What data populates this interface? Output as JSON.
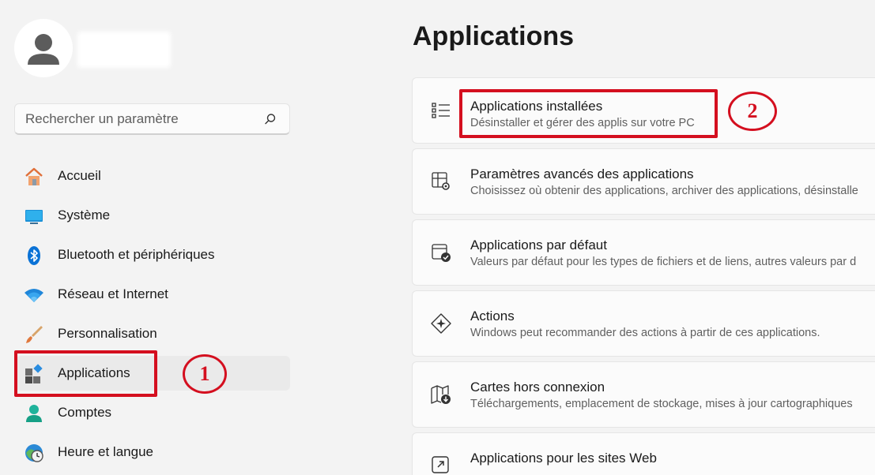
{
  "sidebar": {
    "search_placeholder": "Rechercher un paramètre",
    "items": [
      {
        "label": "Accueil",
        "icon": "home-icon"
      },
      {
        "label": "Système",
        "icon": "monitor-icon"
      },
      {
        "label": "Bluetooth et périphériques",
        "icon": "bluetooth-icon"
      },
      {
        "label": "Réseau et Internet",
        "icon": "wifi-icon"
      },
      {
        "label": "Personnalisation",
        "icon": "brush-icon"
      },
      {
        "label": "Applications",
        "icon": "apps-icon",
        "active": true
      },
      {
        "label": "Comptes",
        "icon": "person-icon"
      },
      {
        "label": "Heure et langue",
        "icon": "clock-globe-icon"
      }
    ]
  },
  "main": {
    "title": "Applications",
    "cards": [
      {
        "title": "Applications installées",
        "desc": "Désinstaller et gérer des applis sur votre PC",
        "icon": "list-icon"
      },
      {
        "title": "Paramètres avancés des applications",
        "desc": "Choisissez où obtenir des applications, archiver des applications, désinstalle",
        "icon": "app-settings-icon"
      },
      {
        "title": "Applications par défaut",
        "desc": "Valeurs par défaut pour les types de fichiers et de liens, autres valeurs par d",
        "icon": "default-apps-icon"
      },
      {
        "title": "Actions",
        "desc": "Windows peut recommander des actions à partir de ces applications.",
        "icon": "actions-icon"
      },
      {
        "title": "Cartes hors connexion",
        "desc": "Téléchargements, emplacement de stockage, mises à jour cartographiques",
        "icon": "offline-map-icon"
      },
      {
        "title": "Applications pour les sites Web",
        "desc": "",
        "icon": "web-apps-icon"
      }
    ]
  },
  "annotations": {
    "marker_1": "1",
    "marker_2": "2",
    "color": "#d40f1f"
  },
  "colors": {
    "background": "#f3f3f3",
    "card": "#fbfbfb",
    "accent": "#0067c0"
  }
}
